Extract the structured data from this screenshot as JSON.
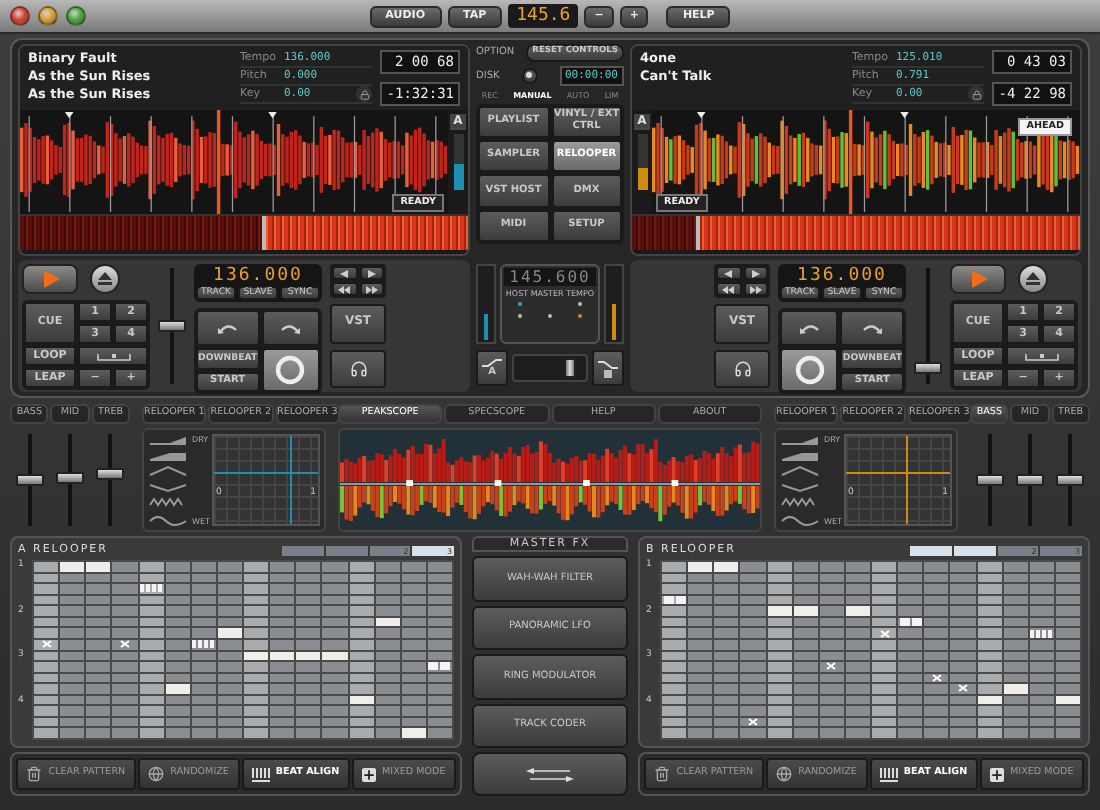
{
  "toolbar": {
    "audio": "AUDIO",
    "tap": "TAP",
    "tempo": "145.6",
    "decrement": "−",
    "increment": "+",
    "help": "HELP"
  },
  "decks": [
    {
      "kind": "left",
      "color": "#1d8fb0",
      "lines": [
        "Binary Fault",
        "As the Sun Rises",
        "As the Sun Rises"
      ],
      "params": [
        {
          "label": "Tempo",
          "value": "136.000"
        },
        {
          "label": "Pitch",
          "value": "0.000"
        },
        {
          "label": "Key",
          "value": "0.00"
        }
      ],
      "elapsed": "2 00 68",
      "remaining": "-1:32:31",
      "letter": "A",
      "status": "READY",
      "meter": {
        "level": 0.45
      },
      "overview": {
        "level": 0.55
      },
      "bpm": "136.000",
      "sync": [
        "TRACK",
        "SLAVE",
        "SYNC"
      ],
      "cue": "CUE",
      "hotcues": [
        "1",
        "2",
        "3",
        "4"
      ],
      "loop": "LOOP",
      "leap": "LEAP",
      "leap_minus": "−",
      "leap_plus": "+",
      "pitch_fader": {
        "level": 0.5
      },
      "downbeat": "DOWNBEAT",
      "start": "START",
      "vst": "VST",
      "channel": {
        "level": 0.35
      },
      "eq": [
        {
          "label": "BASS",
          "selected": false,
          "level": 0.5
        },
        {
          "label": "MID",
          "selected": false,
          "level": 0.52
        },
        {
          "label": "TREB",
          "selected": false,
          "level": 0.58
        }
      ],
      "fx_tabs": [
        "RELOOPER 1",
        "RELOOPER 2",
        "RELOOPER 3"
      ],
      "xy": {
        "dry": "DRY",
        "wet": "WET",
        "min": "0",
        "max": "1",
        "horizontal": {
          "level": 0.6
        },
        "vertical": {
          "level": 0.75
        }
      },
      "relooper": {
        "title": "A RELOOPER",
        "segments": [
          {
            "selected": false
          },
          {
            "selected": false
          },
          {
            "label": "2",
            "selected": false
          },
          {
            "label": "3",
            "selected": true
          }
        ],
        "row_labels": [
          "1",
          "2",
          "3",
          "4"
        ],
        "pattern": [
          [
            {
              "kind": "rest"
            },
            {
              "kind": "note"
            },
            {
              "kind": "note"
            },
            {
              "kind": "rest"
            },
            {
              "kind": "rest"
            },
            {
              "kind": "rest"
            },
            {
              "kind": "rest"
            },
            {
              "kind": "rest"
            },
            {
              "kind": "rest"
            },
            {
              "kind": "rest"
            },
            {
              "kind": "rest"
            },
            {
              "kind": "rest"
            },
            {
              "kind": "rest"
            },
            {
              "kind": "rest"
            },
            {
              "kind": "rest"
            },
            {
              "kind": "rest"
            }
          ],
          [
            {
              "kind": "rest"
            },
            {
              "kind": "rest"
            },
            {
              "kind": "rest"
            },
            {
              "kind": "rest"
            },
            {
              "kind": "rest"
            },
            {
              "kind": "rest"
            },
            {
              "kind": "rest"
            },
            {
              "kind": "rest"
            },
            {
              "kind": "rest"
            },
            {
              "kind": "rest"
            },
            {
              "kind": "rest"
            },
            {
              "kind": "rest"
            },
            {
              "kind": "rest"
            },
            {
              "kind": "rest"
            },
            {
              "kind": "rest"
            },
            {
              "kind": "rest"
            }
          ],
          [
            {
              "kind": "rest"
            },
            {
              "kind": "rest"
            },
            {
              "kind": "rest"
            },
            {
              "kind": "rest"
            },
            {
              "kind": "stutter"
            },
            {
              "kind": "rest"
            },
            {
              "kind": "rest"
            },
            {
              "kind": "rest"
            },
            {
              "kind": "rest"
            },
            {
              "kind": "rest"
            },
            {
              "kind": "rest"
            },
            {
              "kind": "rest"
            },
            {
              "kind": "rest"
            },
            {
              "kind": "rest"
            },
            {
              "kind": "rest"
            },
            {
              "kind": "rest"
            }
          ],
          [
            {
              "kind": "rest"
            },
            {
              "kind": "rest"
            },
            {
              "kind": "rest"
            },
            {
              "kind": "rest"
            },
            {
              "kind": "rest"
            },
            {
              "kind": "rest"
            },
            {
              "kind": "rest"
            },
            {
              "kind": "rest"
            },
            {
              "kind": "rest"
            },
            {
              "kind": "rest"
            },
            {
              "kind": "rest"
            },
            {
              "kind": "rest"
            },
            {
              "kind": "rest"
            },
            {
              "kind": "rest"
            },
            {
              "kind": "rest"
            },
            {
              "kind": "rest"
            }
          ],
          [
            {
              "kind": "rest"
            },
            {
              "kind": "rest"
            },
            {
              "kind": "rest"
            },
            {
              "kind": "rest"
            },
            {
              "kind": "rest"
            },
            {
              "kind": "rest"
            },
            {
              "kind": "rest"
            },
            {
              "kind": "rest"
            },
            {
              "kind": "rest"
            },
            {
              "kind": "rest"
            },
            {
              "kind": "rest"
            },
            {
              "kind": "rest"
            },
            {
              "kind": "rest"
            },
            {
              "kind": "rest"
            },
            {
              "kind": "rest"
            },
            {
              "kind": "rest"
            }
          ],
          [
            {
              "kind": "rest"
            },
            {
              "kind": "rest"
            },
            {
              "kind": "rest"
            },
            {
              "kind": "rest"
            },
            {
              "kind": "rest"
            },
            {
              "kind": "rest"
            },
            {
              "kind": "rest"
            },
            {
              "kind": "rest"
            },
            {
              "kind": "rest"
            },
            {
              "kind": "rest"
            },
            {
              "kind": "rest"
            },
            {
              "kind": "rest"
            },
            {
              "kind": "rest"
            },
            {
              "kind": "note"
            },
            {
              "kind": "rest"
            },
            {
              "kind": "rest"
            }
          ],
          [
            {
              "kind": "rest"
            },
            {
              "kind": "rest"
            },
            {
              "kind": "rest"
            },
            {
              "kind": "rest"
            },
            {
              "kind": "rest"
            },
            {
              "kind": "rest"
            },
            {
              "kind": "rest"
            },
            {
              "kind": "note"
            },
            {
              "kind": "rest"
            },
            {
              "kind": "rest"
            },
            {
              "kind": "rest"
            },
            {
              "kind": "rest"
            },
            {
              "kind": "rest"
            },
            {
              "kind": "rest"
            },
            {
              "kind": "rest"
            },
            {
              "kind": "rest"
            }
          ],
          [
            {
              "kind": "cross"
            },
            {
              "kind": "rest"
            },
            {
              "kind": "rest"
            },
            {
              "kind": "cross"
            },
            {
              "kind": "rest"
            },
            {
              "kind": "rest"
            },
            {
              "kind": "stutter"
            },
            {
              "kind": "rest"
            },
            {
              "kind": "rest"
            },
            {
              "kind": "rest"
            },
            {
              "kind": "rest"
            },
            {
              "kind": "rest"
            },
            {
              "kind": "rest"
            },
            {
              "kind": "rest"
            },
            {
              "kind": "rest"
            },
            {
              "kind": "rest"
            }
          ],
          [
            {
              "kind": "rest"
            },
            {
              "kind": "rest"
            },
            {
              "kind": "rest"
            },
            {
              "kind": "rest"
            },
            {
              "kind": "rest"
            },
            {
              "kind": "rest"
            },
            {
              "kind": "rest"
            },
            {
              "kind": "rest"
            },
            {
              "kind": "note"
            },
            {
              "kind": "note"
            },
            {
              "kind": "note"
            },
            {
              "kind": "note"
            },
            {
              "kind": "rest"
            },
            {
              "kind": "rest"
            },
            {
              "kind": "rest"
            },
            {
              "kind": "rest"
            }
          ],
          [
            {
              "kind": "rest"
            },
            {
              "kind": "rest"
            },
            {
              "kind": "rest"
            },
            {
              "kind": "rest"
            },
            {
              "kind": "rest"
            },
            {
              "kind": "rest"
            },
            {
              "kind": "rest"
            },
            {
              "kind": "rest"
            },
            {
              "kind": "rest"
            },
            {
              "kind": "rest"
            },
            {
              "kind": "rest"
            },
            {
              "kind": "rest"
            },
            {
              "kind": "rest"
            },
            {
              "kind": "rest"
            },
            {
              "kind": "rest"
            },
            {
              "kind": "split"
            }
          ],
          [
            {
              "kind": "rest"
            },
            {
              "kind": "rest"
            },
            {
              "kind": "rest"
            },
            {
              "kind": "rest"
            },
            {
              "kind": "rest"
            },
            {
              "kind": "rest"
            },
            {
              "kind": "rest"
            },
            {
              "kind": "rest"
            },
            {
              "kind": "rest"
            },
            {
              "kind": "rest"
            },
            {
              "kind": "rest"
            },
            {
              "kind": "rest"
            },
            {
              "kind": "rest"
            },
            {
              "kind": "rest"
            },
            {
              "kind": "rest"
            },
            {
              "kind": "rest"
            }
          ],
          [
            {
              "kind": "rest"
            },
            {
              "kind": "rest"
            },
            {
              "kind": "rest"
            },
            {
              "kind": "rest"
            },
            {
              "kind": "rest"
            },
            {
              "kind": "note"
            },
            {
              "kind": "rest"
            },
            {
              "kind": "rest"
            },
            {
              "kind": "rest"
            },
            {
              "kind": "rest"
            },
            {
              "kind": "rest"
            },
            {
              "kind": "rest"
            },
            {
              "kind": "rest"
            },
            {
              "kind": "rest"
            },
            {
              "kind": "rest"
            },
            {
              "kind": "rest"
            }
          ],
          [
            {
              "kind": "rest"
            },
            {
              "kind": "rest"
            },
            {
              "kind": "rest"
            },
            {
              "kind": "rest"
            },
            {
              "kind": "rest"
            },
            {
              "kind": "rest"
            },
            {
              "kind": "rest"
            },
            {
              "kind": "rest"
            },
            {
              "kind": "rest"
            },
            {
              "kind": "rest"
            },
            {
              "kind": "rest"
            },
            {
              "kind": "rest"
            },
            {
              "kind": "note"
            },
            {
              "kind": "rest"
            },
            {
              "kind": "rest"
            },
            {
              "kind": "rest"
            }
          ],
          [
            {
              "kind": "rest"
            },
            {
              "kind": "rest"
            },
            {
              "kind": "rest"
            },
            {
              "kind": "rest"
            },
            {
              "kind": "rest"
            },
            {
              "kind": "rest"
            },
            {
              "kind": "rest"
            },
            {
              "kind": "rest"
            },
            {
              "kind": "rest"
            },
            {
              "kind": "rest"
            },
            {
              "kind": "rest"
            },
            {
              "kind": "rest"
            },
            {
              "kind": "rest"
            },
            {
              "kind": "rest"
            },
            {
              "kind": "rest"
            },
            {
              "kind": "rest"
            }
          ],
          [
            {
              "kind": "rest"
            },
            {
              "kind": "rest"
            },
            {
              "kind": "rest"
            },
            {
              "kind": "rest"
            },
            {
              "kind": "rest"
            },
            {
              "kind": "rest"
            },
            {
              "kind": "rest"
            },
            {
              "kind": "rest"
            },
            {
              "kind": "rest"
            },
            {
              "kind": "rest"
            },
            {
              "kind": "rest"
            },
            {
              "kind": "rest"
            },
            {
              "kind": "rest"
            },
            {
              "kind": "rest"
            },
            {
              "kind": "rest"
            },
            {
              "kind": "rest"
            }
          ],
          [
            {
              "kind": "rest"
            },
            {
              "kind": "rest"
            },
            {
              "kind": "rest"
            },
            {
              "kind": "rest"
            },
            {
              "kind": "rest"
            },
            {
              "kind": "rest"
            },
            {
              "kind": "rest"
            },
            {
              "kind": "rest"
            },
            {
              "kind": "rest"
            },
            {
              "kind": "rest"
            },
            {
              "kind": "rest"
            },
            {
              "kind": "rest"
            },
            {
              "kind": "rest"
            },
            {
              "kind": "rest"
            },
            {
              "kind": "note"
            },
            {
              "kind": "rest"
            }
          ]
        ]
      },
      "actions": [
        {
          "kind": "clear",
          "label": "CLEAR PATTERN",
          "selected": false
        },
        {
          "kind": "randomize",
          "label": "RANDOMIZE",
          "selected": false
        },
        {
          "kind": "align",
          "label": "BEAT ALIGN",
          "selected": true
        },
        {
          "kind": "mixed",
          "label": "MIXED MODE",
          "selected": false
        }
      ]
    },
    {
      "kind": "right",
      "color": "#d08a10",
      "lines": [
        "4one",
        "Can't Talk"
      ],
      "params": [
        {
          "label": "Tempo",
          "value": "125.010"
        },
        {
          "label": "Pitch",
          "value": "0.791"
        },
        {
          "label": "Key",
          "value": "0.00"
        }
      ],
      "elapsed": "0 43 03",
      "remaining": "-4 22 98",
      "letter": "A",
      "status": "READY",
      "badge": "AHEAD",
      "meter": {
        "level": 0.4
      },
      "overview": {
        "level": 0.15
      },
      "bpm": "136.000",
      "sync": [
        "TRACK",
        "SLAVE",
        "SYNC"
      ],
      "cue": "CUE",
      "hotcues": [
        "1",
        "2",
        "3",
        "4"
      ],
      "loop": "LOOP",
      "leap": "LEAP",
      "leap_minus": "−",
      "leap_plus": "+",
      "pitch_fader": {
        "level": 0.1
      },
      "downbeat": "DOWNBEAT",
      "start": "START",
      "vst": "VST",
      "channel": {
        "level": 0.5
      },
      "eq": [
        {
          "label": "BASS",
          "selected": true,
          "level": 0.5
        },
        {
          "label": "MID",
          "selected": false,
          "level": 0.5
        },
        {
          "label": "TREB",
          "selected": false,
          "level": 0.5
        }
      ],
      "fx_tabs": [
        "RELOOPER 1",
        "RELOOPER 2",
        "RELOOPER 3"
      ],
      "xy": {
        "dry": "DRY",
        "wet": "WET",
        "min": "0",
        "max": "1",
        "horizontal": {
          "level": 0.6
        },
        "vertical": {
          "level": 0.6
        }
      },
      "relooper": {
        "title": "B RELOOPER",
        "segments": [
          {
            "selected": true
          },
          {
            "selected": true
          },
          {
            "label": "2",
            "selected": false
          },
          {
            "label": "3",
            "selected": false
          }
        ],
        "row_labels": [
          "1",
          "2",
          "3",
          "4"
        ],
        "pattern": [
          [
            {
              "kind": "rest"
            },
            {
              "kind": "note"
            },
            {
              "kind": "note"
            },
            {
              "kind": "rest"
            },
            {
              "kind": "rest"
            },
            {
              "kind": "rest"
            },
            {
              "kind": "rest"
            },
            {
              "kind": "rest"
            },
            {
              "kind": "rest"
            },
            {
              "kind": "rest"
            },
            {
              "kind": "rest"
            },
            {
              "kind": "rest"
            },
            {
              "kind": "rest"
            },
            {
              "kind": "rest"
            },
            {
              "kind": "rest"
            },
            {
              "kind": "rest"
            }
          ],
          [
            {
              "kind": "rest"
            },
            {
              "kind": "rest"
            },
            {
              "kind": "rest"
            },
            {
              "kind": "rest"
            },
            {
              "kind": "rest"
            },
            {
              "kind": "rest"
            },
            {
              "kind": "rest"
            },
            {
              "kind": "rest"
            },
            {
              "kind": "rest"
            },
            {
              "kind": "rest"
            },
            {
              "kind": "rest"
            },
            {
              "kind": "rest"
            },
            {
              "kind": "rest"
            },
            {
              "kind": "rest"
            },
            {
              "kind": "rest"
            },
            {
              "kind": "rest"
            }
          ],
          [
            {
              "kind": "rest"
            },
            {
              "kind": "rest"
            },
            {
              "kind": "rest"
            },
            {
              "kind": "rest"
            },
            {
              "kind": "rest"
            },
            {
              "kind": "rest"
            },
            {
              "kind": "rest"
            },
            {
              "kind": "rest"
            },
            {
              "kind": "rest"
            },
            {
              "kind": "rest"
            },
            {
              "kind": "rest"
            },
            {
              "kind": "rest"
            },
            {
              "kind": "rest"
            },
            {
              "kind": "rest"
            },
            {
              "kind": "rest"
            },
            {
              "kind": "rest"
            }
          ],
          [
            {
              "kind": "split"
            },
            {
              "kind": "rest"
            },
            {
              "kind": "rest"
            },
            {
              "kind": "rest"
            },
            {
              "kind": "rest"
            },
            {
              "kind": "rest"
            },
            {
              "kind": "rest"
            },
            {
              "kind": "rest"
            },
            {
              "kind": "rest"
            },
            {
              "kind": "rest"
            },
            {
              "kind": "rest"
            },
            {
              "kind": "rest"
            },
            {
              "kind": "rest"
            },
            {
              "kind": "rest"
            },
            {
              "kind": "rest"
            },
            {
              "kind": "rest"
            }
          ],
          [
            {
              "kind": "rest"
            },
            {
              "kind": "rest"
            },
            {
              "kind": "rest"
            },
            {
              "kind": "rest"
            },
            {
              "kind": "note"
            },
            {
              "kind": "note"
            },
            {
              "kind": "rest"
            },
            {
              "kind": "note"
            },
            {
              "kind": "rest"
            },
            {
              "kind": "rest"
            },
            {
              "kind": "rest"
            },
            {
              "kind": "rest"
            },
            {
              "kind": "rest"
            },
            {
              "kind": "rest"
            },
            {
              "kind": "rest"
            },
            {
              "kind": "rest"
            }
          ],
          [
            {
              "kind": "rest"
            },
            {
              "kind": "rest"
            },
            {
              "kind": "rest"
            },
            {
              "kind": "rest"
            },
            {
              "kind": "rest"
            },
            {
              "kind": "rest"
            },
            {
              "kind": "rest"
            },
            {
              "kind": "rest"
            },
            {
              "kind": "rest"
            },
            {
              "kind": "split"
            },
            {
              "kind": "rest"
            },
            {
              "kind": "rest"
            },
            {
              "kind": "rest"
            },
            {
              "kind": "rest"
            },
            {
              "kind": "rest"
            },
            {
              "kind": "rest"
            }
          ],
          [
            {
              "kind": "rest"
            },
            {
              "kind": "rest"
            },
            {
              "kind": "rest"
            },
            {
              "kind": "rest"
            },
            {
              "kind": "rest"
            },
            {
              "kind": "rest"
            },
            {
              "kind": "rest"
            },
            {
              "kind": "rest"
            },
            {
              "kind": "cross"
            },
            {
              "kind": "rest"
            },
            {
              "kind": "rest"
            },
            {
              "kind": "rest"
            },
            {
              "kind": "rest"
            },
            {
              "kind": "rest"
            },
            {
              "kind": "stutter"
            },
            {
              "kind": "rest"
            }
          ],
          [
            {
              "kind": "rest"
            },
            {
              "kind": "rest"
            },
            {
              "kind": "rest"
            },
            {
              "kind": "rest"
            },
            {
              "kind": "rest"
            },
            {
              "kind": "rest"
            },
            {
              "kind": "rest"
            },
            {
              "kind": "rest"
            },
            {
              "kind": "rest"
            },
            {
              "kind": "rest"
            },
            {
              "kind": "rest"
            },
            {
              "kind": "rest"
            },
            {
              "kind": "rest"
            },
            {
              "kind": "rest"
            },
            {
              "kind": "rest"
            },
            {
              "kind": "rest"
            }
          ],
          [
            {
              "kind": "rest"
            },
            {
              "kind": "rest"
            },
            {
              "kind": "rest"
            },
            {
              "kind": "rest"
            },
            {
              "kind": "rest"
            },
            {
              "kind": "rest"
            },
            {
              "kind": "rest"
            },
            {
              "kind": "rest"
            },
            {
              "kind": "rest"
            },
            {
              "kind": "rest"
            },
            {
              "kind": "rest"
            },
            {
              "kind": "rest"
            },
            {
              "kind": "rest"
            },
            {
              "kind": "rest"
            },
            {
              "kind": "rest"
            },
            {
              "kind": "rest"
            }
          ],
          [
            {
              "kind": "rest"
            },
            {
              "kind": "rest"
            },
            {
              "kind": "rest"
            },
            {
              "kind": "rest"
            },
            {
              "kind": "rest"
            },
            {
              "kind": "rest"
            },
            {
              "kind": "cross"
            },
            {
              "kind": "rest"
            },
            {
              "kind": "rest"
            },
            {
              "kind": "rest"
            },
            {
              "kind": "rest"
            },
            {
              "kind": "rest"
            },
            {
              "kind": "rest"
            },
            {
              "kind": "rest"
            },
            {
              "kind": "rest"
            },
            {
              "kind": "rest"
            }
          ],
          [
            {
              "kind": "rest"
            },
            {
              "kind": "rest"
            },
            {
              "kind": "rest"
            },
            {
              "kind": "rest"
            },
            {
              "kind": "rest"
            },
            {
              "kind": "rest"
            },
            {
              "kind": "rest"
            },
            {
              "kind": "rest"
            },
            {
              "kind": "rest"
            },
            {
              "kind": "rest"
            },
            {
              "kind": "cross"
            },
            {
              "kind": "rest"
            },
            {
              "kind": "rest"
            },
            {
              "kind": "rest"
            },
            {
              "kind": "rest"
            },
            {
              "kind": "rest"
            }
          ],
          [
            {
              "kind": "rest"
            },
            {
              "kind": "rest"
            },
            {
              "kind": "rest"
            },
            {
              "kind": "rest"
            },
            {
              "kind": "rest"
            },
            {
              "kind": "rest"
            },
            {
              "kind": "rest"
            },
            {
              "kind": "rest"
            },
            {
              "kind": "rest"
            },
            {
              "kind": "rest"
            },
            {
              "kind": "rest"
            },
            {
              "kind": "cross"
            },
            {
              "kind": "rest"
            },
            {
              "kind": "note"
            },
            {
              "kind": "rest"
            },
            {
              "kind": "rest"
            }
          ],
          [
            {
              "kind": "rest"
            },
            {
              "kind": "rest"
            },
            {
              "kind": "rest"
            },
            {
              "kind": "rest"
            },
            {
              "kind": "rest"
            },
            {
              "kind": "rest"
            },
            {
              "kind": "rest"
            },
            {
              "kind": "rest"
            },
            {
              "kind": "rest"
            },
            {
              "kind": "rest"
            },
            {
              "kind": "rest"
            },
            {
              "kind": "rest"
            },
            {
              "kind": "note"
            },
            {
              "kind": "rest"
            },
            {
              "kind": "rest"
            },
            {
              "kind": "note"
            }
          ],
          [
            {
              "kind": "rest"
            },
            {
              "kind": "rest"
            },
            {
              "kind": "rest"
            },
            {
              "kind": "rest"
            },
            {
              "kind": "rest"
            },
            {
              "kind": "rest"
            },
            {
              "kind": "rest"
            },
            {
              "kind": "rest"
            },
            {
              "kind": "rest"
            },
            {
              "kind": "rest"
            },
            {
              "kind": "rest"
            },
            {
              "kind": "rest"
            },
            {
              "kind": "rest"
            },
            {
              "kind": "rest"
            },
            {
              "kind": "rest"
            },
            {
              "kind": "rest"
            }
          ],
          [
            {
              "kind": "rest"
            },
            {
              "kind": "rest"
            },
            {
              "kind": "rest"
            },
            {
              "kind": "cross"
            },
            {
              "kind": "rest"
            },
            {
              "kind": "rest"
            },
            {
              "kind": "rest"
            },
            {
              "kind": "rest"
            },
            {
              "kind": "rest"
            },
            {
              "kind": "rest"
            },
            {
              "kind": "rest"
            },
            {
              "kind": "rest"
            },
            {
              "kind": "rest"
            },
            {
              "kind": "rest"
            },
            {
              "kind": "rest"
            },
            {
              "kind": "rest"
            }
          ],
          [
            {
              "kind": "rest"
            },
            {
              "kind": "rest"
            },
            {
              "kind": "rest"
            },
            {
              "kind": "rest"
            },
            {
              "kind": "rest"
            },
            {
              "kind": "rest"
            },
            {
              "kind": "rest"
            },
            {
              "kind": "rest"
            },
            {
              "kind": "rest"
            },
            {
              "kind": "rest"
            },
            {
              "kind": "rest"
            },
            {
              "kind": "rest"
            },
            {
              "kind": "rest"
            },
            {
              "kind": "rest"
            },
            {
              "kind": "rest"
            },
            {
              "kind": "rest"
            }
          ]
        ]
      },
      "actions": [
        {
          "kind": "clear",
          "label": "CLEAR PATTERN",
          "selected": false
        },
        {
          "kind": "randomize",
          "label": "RANDOMIZE",
          "selected": false
        },
        {
          "kind": "align",
          "label": "BEAT ALIGN",
          "selected": true
        },
        {
          "kind": "mixed",
          "label": "MIXED MODE",
          "selected": false
        }
      ]
    }
  ],
  "center": {
    "option": "OPTION",
    "reset": "RESET CONTROLS",
    "disk": "DISK",
    "disk_time": "00:00:00",
    "modes": [
      {
        "label": "REC",
        "selected": false
      },
      {
        "label": "MANUAL",
        "selected": true
      },
      {
        "label": "AUTO",
        "selected": false
      },
      {
        "label": "LIM",
        "selected": false
      }
    ],
    "nav": [
      {
        "label": "PLAYLIST",
        "selected": false
      },
      {
        "label": "VINYL / EXT CTRL",
        "selected": false
      },
      {
        "label": "SAMPLER",
        "selected": false
      },
      {
        "label": "RELOOPER",
        "selected": true
      },
      {
        "label": "VST HOST",
        "selected": false
      },
      {
        "label": "DMX",
        "selected": false
      },
      {
        "label": "MIDI",
        "selected": false
      },
      {
        "label": "SETUP",
        "selected": false
      }
    ],
    "host_tempo": "145.600",
    "host_label": "HOST MASTER TEMPO",
    "crossfader": {
      "level": 0.8
    },
    "curve_letter": "A"
  },
  "scope": {
    "tabs": [
      {
        "label": "PEAKSCOPE",
        "selected": true
      },
      {
        "label": "SPECSCOPE",
        "selected": false
      },
      {
        "label": "HELP",
        "selected": false
      },
      {
        "label": "ABOUT",
        "selected": false
      }
    ]
  },
  "master_fx": {
    "title": "MASTER FX",
    "effects": [
      "WAH-WAH FILTER",
      "PANORAMIC LFO",
      "RING MODULATOR",
      "TRACK CODER"
    ]
  }
}
